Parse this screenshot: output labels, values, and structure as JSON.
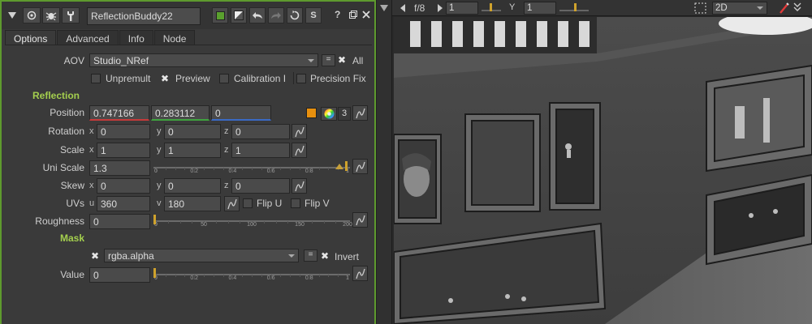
{
  "node": {
    "name": "ReflectionBuddy22",
    "tabs": [
      "Options",
      "Advanced",
      "Info",
      "Node"
    ],
    "active_tab": "Options"
  },
  "titlebar": {
    "help": "?",
    "script_button": "S",
    "node_color": "#5aa02e"
  },
  "aov": {
    "label": "AOV",
    "value": "Studio_NRef",
    "eq_button": "=",
    "all_label": "All"
  },
  "options_row": {
    "unpremult": "Unpremult",
    "preview": "Preview",
    "calibration": "Calibration I",
    "precision_fix": "Precision Fix"
  },
  "reflection": {
    "section": "Reflection",
    "position": {
      "label": "Position",
      "values": [
        "0.747166",
        "0.283112",
        "0"
      ],
      "channel_count": "3"
    },
    "rotation": {
      "label": "Rotation",
      "x": "0",
      "y": "0",
      "z": "0"
    },
    "scale": {
      "label": "Scale",
      "x": "1",
      "y": "1",
      "z": "1"
    },
    "uni_scale": {
      "label": "Uni Scale",
      "value": "1.3",
      "ticks": [
        "0",
        "0.2",
        "0.4",
        "0.6",
        "0.8",
        "1"
      ],
      "level": 1.3
    },
    "skew": {
      "label": "Skew",
      "x": "0",
      "y": "0",
      "z": "0"
    },
    "uvs": {
      "label": "UVs",
      "u": "360",
      "v": "180",
      "flip_u": "Flip U",
      "flip_v": "Flip V"
    },
    "roughness": {
      "label": "Roughness",
      "value": "0",
      "ticks": [
        "0",
        "50",
        "100",
        "150",
        "200"
      ],
      "level": 0
    }
  },
  "mask": {
    "section": "Mask",
    "channel": "rgba.alpha",
    "eq_button": "=",
    "invert": "Invert",
    "value": {
      "label": "Value",
      "value": "0",
      "ticks": [
        "0",
        "0.2",
        "0.4",
        "0.6",
        "0.8",
        "1"
      ],
      "level": 0
    }
  },
  "axes": {
    "x": "x",
    "y": "y",
    "z": "z",
    "u": "u",
    "v": "v"
  },
  "viewer": {
    "fstop": "f/8",
    "frame": "1",
    "gamma_label": "Y",
    "gamma": "1",
    "view_mode": "2D"
  },
  "colors": {
    "accent_green": "#a4cf4e",
    "panel_border": "#5e9a2e",
    "swatch": "#e8900e"
  }
}
